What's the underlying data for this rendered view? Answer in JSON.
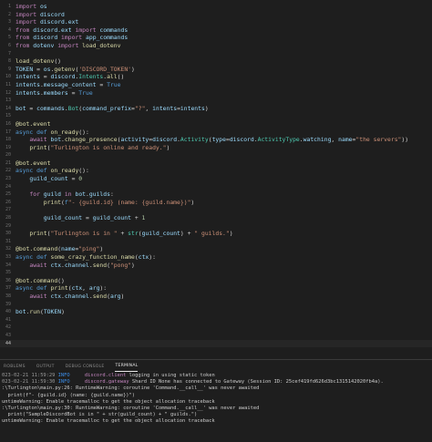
{
  "editor": {
    "lines": [
      {
        "n": "1",
        "segs": [
          [
            "kw2",
            "import"
          ],
          [
            "op",
            " "
          ],
          [
            "var",
            "os"
          ]
        ]
      },
      {
        "n": "2",
        "segs": [
          [
            "kw2",
            "import"
          ],
          [
            "op",
            " "
          ],
          [
            "var",
            "discord"
          ]
        ]
      },
      {
        "n": "3",
        "segs": [
          [
            "kw2",
            "import"
          ],
          [
            "op",
            " "
          ],
          [
            "var",
            "discord.ext"
          ]
        ]
      },
      {
        "n": "4",
        "segs": [
          [
            "kw2",
            "from"
          ],
          [
            "op",
            " "
          ],
          [
            "var",
            "discord.ext"
          ],
          [
            "op",
            " "
          ],
          [
            "kw2",
            "import"
          ],
          [
            "op",
            " "
          ],
          [
            "var",
            "commands"
          ]
        ]
      },
      {
        "n": "5",
        "segs": [
          [
            "kw2",
            "from"
          ],
          [
            "op",
            " "
          ],
          [
            "var",
            "discord"
          ],
          [
            "op",
            " "
          ],
          [
            "kw2",
            "import"
          ],
          [
            "op",
            " "
          ],
          [
            "var",
            "app_commands"
          ]
        ]
      },
      {
        "n": "6",
        "segs": [
          [
            "kw2",
            "from"
          ],
          [
            "op",
            " "
          ],
          [
            "var",
            "dotenv"
          ],
          [
            "op",
            " "
          ],
          [
            "kw2",
            "import"
          ],
          [
            "op",
            " "
          ],
          [
            "fn",
            "load_dotenv"
          ]
        ]
      },
      {
        "n": "7",
        "segs": []
      },
      {
        "n": "8",
        "segs": [
          [
            "fn",
            "load_dotenv"
          ],
          [
            "op",
            "()"
          ]
        ]
      },
      {
        "n": "9",
        "segs": [
          [
            "var",
            "TOKEN"
          ],
          [
            "op",
            " = "
          ],
          [
            "var",
            "os"
          ],
          [
            "op",
            "."
          ],
          [
            "fn",
            "getenv"
          ],
          [
            "op",
            "("
          ],
          [
            "str",
            "'DISCORD_TOKEN'"
          ],
          [
            "op",
            ")"
          ]
        ]
      },
      {
        "n": "10",
        "segs": [
          [
            "var",
            "intents"
          ],
          [
            "op",
            " = "
          ],
          [
            "var",
            "discord"
          ],
          [
            "op",
            "."
          ],
          [
            "cls",
            "Intents"
          ],
          [
            "op",
            "."
          ],
          [
            "fn",
            "all"
          ],
          [
            "op",
            "()"
          ]
        ]
      },
      {
        "n": "11",
        "segs": [
          [
            "var",
            "intents"
          ],
          [
            "op",
            "."
          ],
          [
            "var",
            "message_content"
          ],
          [
            "op",
            " = "
          ],
          [
            "kw",
            "True"
          ]
        ]
      },
      {
        "n": "12",
        "segs": [
          [
            "var",
            "intents"
          ],
          [
            "op",
            "."
          ],
          [
            "var",
            "members"
          ],
          [
            "op",
            " = "
          ],
          [
            "kw",
            "True"
          ]
        ]
      },
      {
        "n": "13",
        "segs": []
      },
      {
        "n": "14",
        "segs": [
          [
            "var",
            "bot"
          ],
          [
            "op",
            " = "
          ],
          [
            "var",
            "commands"
          ],
          [
            "op",
            "."
          ],
          [
            "cls",
            "Bot"
          ],
          [
            "op",
            "("
          ],
          [
            "var",
            "command_prefix"
          ],
          [
            "op",
            "="
          ],
          [
            "str",
            "\"?\""
          ],
          [
            "op",
            ", "
          ],
          [
            "var",
            "intents"
          ],
          [
            "op",
            "="
          ],
          [
            "var",
            "intents"
          ],
          [
            "op",
            ")"
          ]
        ]
      },
      {
        "n": "15",
        "segs": []
      },
      {
        "n": "16",
        "segs": [
          [
            "dec",
            "@bot.event"
          ]
        ]
      },
      {
        "n": "17",
        "segs": [
          [
            "kw",
            "async"
          ],
          [
            "op",
            " "
          ],
          [
            "kw",
            "def"
          ],
          [
            "op",
            " "
          ],
          [
            "fn",
            "on_ready"
          ],
          [
            "op",
            "():"
          ]
        ]
      },
      {
        "n": "18",
        "segs": [
          [
            "op",
            "    "
          ],
          [
            "kw2",
            "await"
          ],
          [
            "op",
            " "
          ],
          [
            "var",
            "bot"
          ],
          [
            "op",
            "."
          ],
          [
            "fn",
            "change_presence"
          ],
          [
            "op",
            "("
          ],
          [
            "var",
            "activity"
          ],
          [
            "op",
            "="
          ],
          [
            "var",
            "discord"
          ],
          [
            "op",
            "."
          ],
          [
            "cls",
            "Activity"
          ],
          [
            "op",
            "("
          ],
          [
            "var",
            "type"
          ],
          [
            "op",
            "="
          ],
          [
            "var",
            "discord"
          ],
          [
            "op",
            "."
          ],
          [
            "cls",
            "ActivityType"
          ],
          [
            "op",
            "."
          ],
          [
            "var",
            "watching"
          ],
          [
            "op",
            ", "
          ],
          [
            "var",
            "name"
          ],
          [
            "op",
            "="
          ],
          [
            "str",
            "\"the servers\""
          ],
          [
            "op",
            "))"
          ]
        ]
      },
      {
        "n": "19",
        "segs": [
          [
            "op",
            "    "
          ],
          [
            "fn",
            "print"
          ],
          [
            "op",
            "("
          ],
          [
            "str",
            "\"Turlington is online and ready.\""
          ],
          [
            "op",
            ")"
          ]
        ]
      },
      {
        "n": "20",
        "segs": []
      },
      {
        "n": "21",
        "segs": [
          [
            "dec",
            "@bot.event"
          ]
        ]
      },
      {
        "n": "22",
        "segs": [
          [
            "kw",
            "async"
          ],
          [
            "op",
            " "
          ],
          [
            "kw",
            "def"
          ],
          [
            "op",
            " "
          ],
          [
            "fn",
            "on_ready"
          ],
          [
            "op",
            "():"
          ]
        ]
      },
      {
        "n": "23",
        "segs": [
          [
            "op",
            "    "
          ],
          [
            "var",
            "guild_count"
          ],
          [
            "op",
            " = "
          ],
          [
            "num",
            "0"
          ]
        ]
      },
      {
        "n": "24",
        "segs": []
      },
      {
        "n": "25",
        "segs": [
          [
            "op",
            "    "
          ],
          [
            "kw2",
            "for"
          ],
          [
            "op",
            " "
          ],
          [
            "var",
            "guild"
          ],
          [
            "op",
            " "
          ],
          [
            "kw2",
            "in"
          ],
          [
            "op",
            " "
          ],
          [
            "var",
            "bot"
          ],
          [
            "op",
            "."
          ],
          [
            "var",
            "guilds"
          ],
          [
            "op",
            ":"
          ]
        ]
      },
      {
        "n": "26",
        "segs": [
          [
            "op",
            "        "
          ],
          [
            "fn",
            "print"
          ],
          [
            "op",
            "("
          ],
          [
            "kw",
            "f"
          ],
          [
            "str",
            "\"- {guild.id} (name: {guild.name})\""
          ],
          [
            "op",
            ")"
          ]
        ]
      },
      {
        "n": "27",
        "segs": []
      },
      {
        "n": "28",
        "segs": [
          [
            "op",
            "        "
          ],
          [
            "var",
            "guild_count"
          ],
          [
            "op",
            " = "
          ],
          [
            "var",
            "guild_count"
          ],
          [
            "op",
            " + "
          ],
          [
            "num",
            "1"
          ]
        ]
      },
      {
        "n": "29",
        "segs": []
      },
      {
        "n": "30",
        "segs": [
          [
            "op",
            "    "
          ],
          [
            "fn",
            "print"
          ],
          [
            "op",
            "("
          ],
          [
            "str",
            "\"Turlington is in \""
          ],
          [
            "op",
            " + "
          ],
          [
            "cls",
            "str"
          ],
          [
            "op",
            "("
          ],
          [
            "var",
            "guild_count"
          ],
          [
            "op",
            ") + "
          ],
          [
            "str",
            "\" guilds.\""
          ],
          [
            "op",
            ")"
          ]
        ]
      },
      {
        "n": "31",
        "segs": []
      },
      {
        "n": "32",
        "segs": [
          [
            "dec",
            "@bot.command"
          ],
          [
            "op",
            "("
          ],
          [
            "var",
            "name"
          ],
          [
            "op",
            "="
          ],
          [
            "str",
            "\"ping\""
          ],
          [
            "op",
            ")"
          ]
        ]
      },
      {
        "n": "33",
        "segs": [
          [
            "kw",
            "async"
          ],
          [
            "op",
            " "
          ],
          [
            "kw",
            "def"
          ],
          [
            "op",
            " "
          ],
          [
            "fn",
            "some_crazy_function_name"
          ],
          [
            "op",
            "("
          ],
          [
            "var",
            "ctx"
          ],
          [
            "op",
            "):"
          ]
        ]
      },
      {
        "n": "34",
        "segs": [
          [
            "op",
            "    "
          ],
          [
            "kw2",
            "await"
          ],
          [
            "op",
            " "
          ],
          [
            "var",
            "ctx"
          ],
          [
            "op",
            "."
          ],
          [
            "var",
            "channel"
          ],
          [
            "op",
            "."
          ],
          [
            "fn",
            "send"
          ],
          [
            "op",
            "("
          ],
          [
            "str",
            "\"pong\""
          ],
          [
            "op",
            ")"
          ]
        ]
      },
      {
        "n": "35",
        "segs": []
      },
      {
        "n": "36",
        "segs": [
          [
            "dec",
            "@bot.command"
          ],
          [
            "op",
            "()"
          ]
        ]
      },
      {
        "n": "37",
        "segs": [
          [
            "kw",
            "async"
          ],
          [
            "op",
            " "
          ],
          [
            "kw",
            "def"
          ],
          [
            "op",
            " "
          ],
          [
            "fn",
            "print"
          ],
          [
            "op",
            "("
          ],
          [
            "var",
            "ctx"
          ],
          [
            "op",
            ", "
          ],
          [
            "var",
            "arg"
          ],
          [
            "op",
            "):"
          ]
        ]
      },
      {
        "n": "38",
        "segs": [
          [
            "op",
            "    "
          ],
          [
            "kw2",
            "await"
          ],
          [
            "op",
            " "
          ],
          [
            "var",
            "ctx"
          ],
          [
            "op",
            "."
          ],
          [
            "var",
            "channel"
          ],
          [
            "op",
            "."
          ],
          [
            "fn",
            "send"
          ],
          [
            "op",
            "("
          ],
          [
            "var",
            "arg"
          ],
          [
            "op",
            ")"
          ]
        ]
      },
      {
        "n": "39",
        "segs": []
      },
      {
        "n": "40",
        "segs": [
          [
            "var",
            "bot"
          ],
          [
            "op",
            "."
          ],
          [
            "fn",
            "run"
          ],
          [
            "op",
            "("
          ],
          [
            "var",
            "TOKEN"
          ],
          [
            "op",
            ")"
          ]
        ]
      },
      {
        "n": "41",
        "segs": []
      },
      {
        "n": "42",
        "segs": []
      },
      {
        "n": "43",
        "segs": []
      },
      {
        "n": "44",
        "segs": [],
        "current": true
      }
    ]
  },
  "panel": {
    "tabs": [
      {
        "label": "ROBLEMS",
        "active": false
      },
      {
        "label": "OUTPUT",
        "active": false
      },
      {
        "label": "DEBUG CONSOLE",
        "active": false
      },
      {
        "label": "TERMINAL",
        "active": true
      }
    ],
    "terminal": [
      {
        "ts": "023-02-21 11:59:29",
        "lvl": "INFO",
        "src": "discord.client",
        "msg": "logging in using static token"
      },
      {
        "ts": "023-02-21 11:59:30",
        "lvl": "INFO",
        "src": "discord.gateway",
        "msg": "Shard ID None has connected to Gateway (Session ID: 25cef419fd626d3bc1315142020fb4a)."
      },
      {
        "text": ":\\Turlington\\main.py:26: RuntimeWarning: coroutine 'Command.__call__' was never awaited"
      },
      {
        "text": "  print(f\"- {guild.id} (name: {guild.name})\")"
      },
      {
        "text": "untimeWarning: Enable tracemalloc to get the object allocation traceback"
      },
      {
        "text": ":\\Turlington\\main.py:30: RuntimeWarning: coroutine 'Command.__call__' was never awaited"
      },
      {
        "text": "  print(\"SampleDiscordBot is in \" + str(guild_count) + \" guilds.\")"
      },
      {
        "text": "untimeWarning: Enable tracemalloc to get the object allocation traceback"
      }
    ]
  }
}
